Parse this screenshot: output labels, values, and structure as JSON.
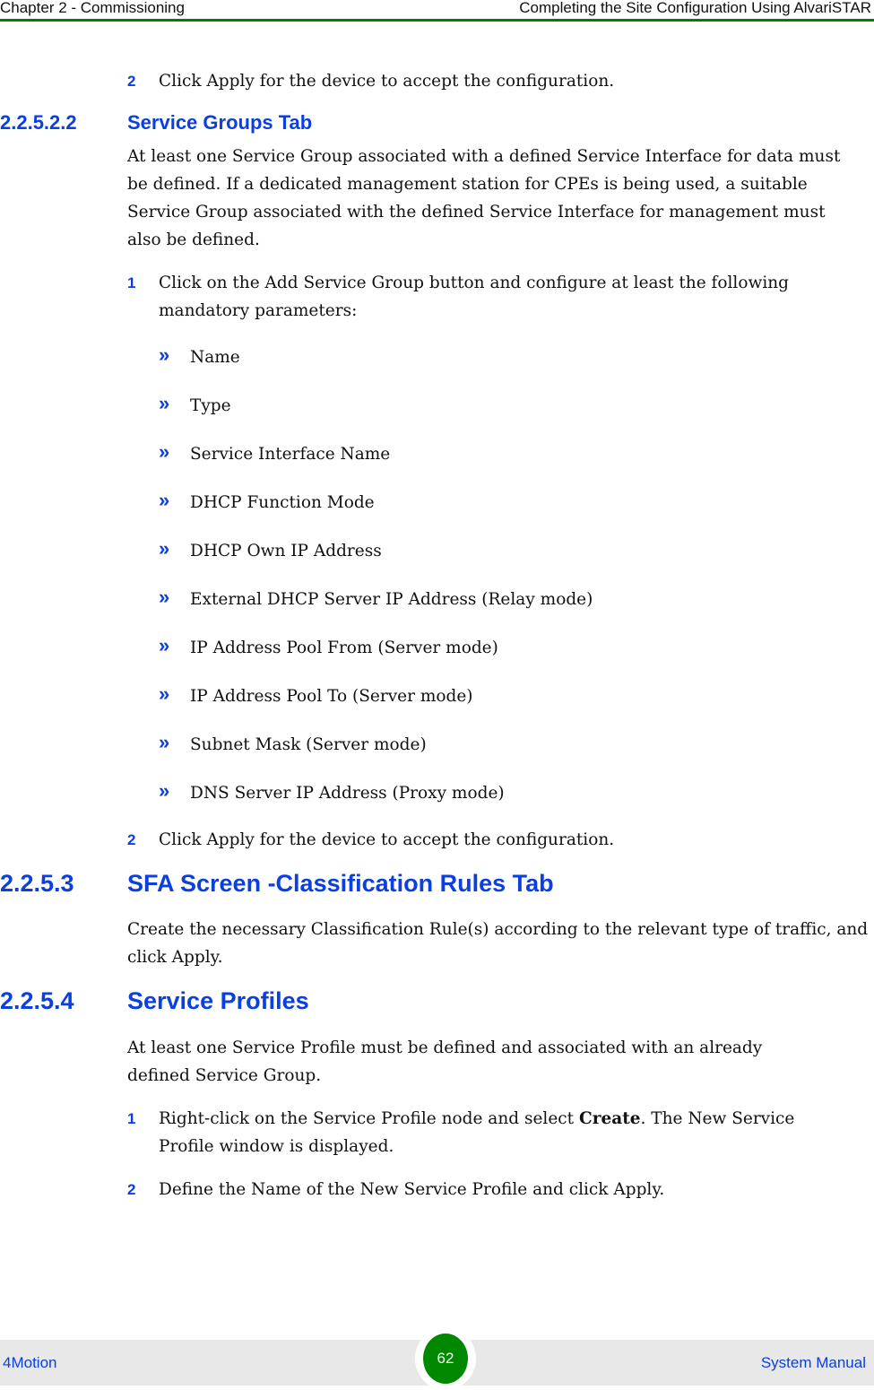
{
  "header": {
    "chapter": "Chapter 2 - Commissioning",
    "section": "Completing the Site Configuration Using AlvariSTAR",
    "accent_color": "#008000"
  },
  "top_step": {
    "number": "2",
    "text": "Click Apply for the device to accept the configuration."
  },
  "service_groups": {
    "number": "2.2.5.2.2",
    "title": "Service Groups Tab",
    "intro": "At least one Service Group associated with a defined Service Interface for data must be defined. If a dedicated management station for CPEs is being used, a suitable Service Group associated with the defined Service Interface for management must also be defined.",
    "step1": {
      "number": "1",
      "text": "Click on the Add Service Group button and configure at least the following mandatory parameters:"
    },
    "parameters": [
      "Name",
      "Type",
      "Service Interface Name",
      "DHCP Function Mode",
      "DHCP Own IP Address",
      "External DHCP Server IP Address (Relay mode)",
      "IP Address Pool From (Server mode)",
      "IP Address Pool To (Server mode)",
      "Subnet Mask (Server mode)",
      "DNS Server IP Address (Proxy mode)"
    ],
    "bullet_icon": "»",
    "step2": {
      "number": "2",
      "text": "Click Apply for the device to accept the configuration."
    }
  },
  "classification": {
    "number": "2.2.5.3",
    "title": "SFA Screen -Classification Rules Tab",
    "text": "Create the necessary Classification Rule(s) according to the relevant type of traffic, and click Apply."
  },
  "service_profiles": {
    "number": "2.2.5.4",
    "title": "Service Profiles",
    "intro": "At least one Service Profile must be defined and associated with an already defined Service Group.",
    "step1": {
      "number": "1",
      "text_before": "Right-click on the Service Profile node and select ",
      "bold": "Create",
      "text_after": ". The New Service Profile window is displayed."
    },
    "step2": {
      "number": "2",
      "text": "Define the Name of the New Service Profile and click Apply."
    }
  },
  "footer": {
    "product": "4Motion",
    "page_number": "62",
    "doc_title": "System Manual",
    "badge_color": "#008800"
  }
}
